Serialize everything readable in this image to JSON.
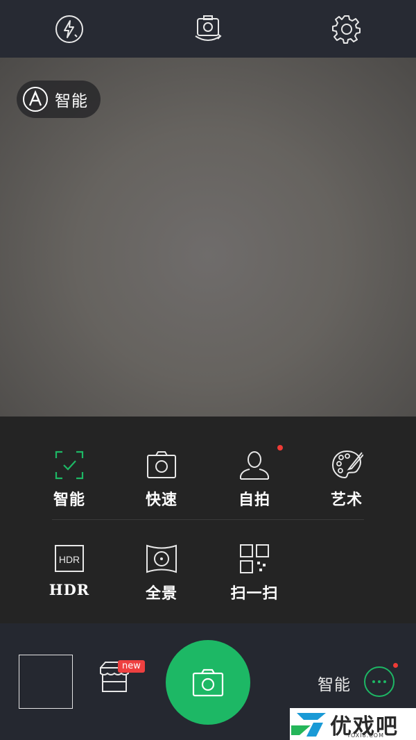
{
  "top_bar": {
    "flash_icon": "flash-auto-icon",
    "switch_camera_icon": "switch-camera-icon",
    "settings_icon": "gear-icon"
  },
  "viewfinder": {
    "mode_chip": {
      "icon": "auto-a-icon",
      "label": "智能"
    }
  },
  "modes": [
    {
      "label": "智能",
      "icon": "smart-frame-icon",
      "active": true,
      "accent": "#1db865"
    },
    {
      "label": "快速",
      "icon": "camera-icon"
    },
    {
      "label": "自拍",
      "icon": "person-icon",
      "has_dot": true
    },
    {
      "label": "艺术",
      "icon": "palette-icon"
    },
    {
      "label": "HDR",
      "icon": "hdr-icon",
      "icon_text": "HDR"
    },
    {
      "label": "全景",
      "icon": "panorama-icon"
    },
    {
      "label": "扫一扫",
      "icon": "qr-scan-icon"
    }
  ],
  "bottom_bar": {
    "new_badge": "new",
    "current_mode": "智能",
    "shutter_color": "#1db865",
    "notification_dot_color": "#ef3b36"
  },
  "watermark": {
    "text": "优戏吧",
    "sub": "YOXI8.COM"
  }
}
